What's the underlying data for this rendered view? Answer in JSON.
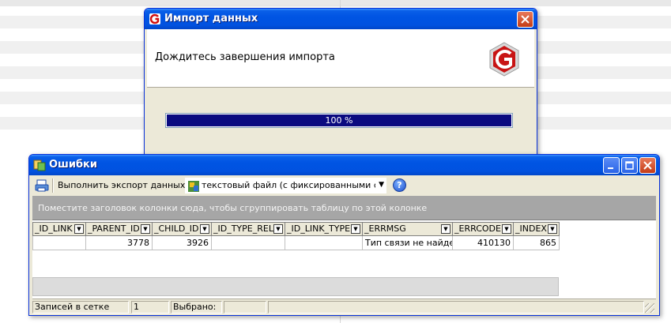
{
  "import_dialog": {
    "title": "Импорт данных",
    "message": "Дождитесь завершения импорта",
    "progress_percent": 100,
    "progress_text": "100 %"
  },
  "errors_window": {
    "title": "Ошибки",
    "toolbar": {
      "export_label": "Выполнить экспорт данных в:",
      "export_format": "текстовый файл (с фиксированными столбц",
      "help_glyph": "?"
    },
    "group_panel_text": "Поместите заголовок колонки сюда, чтобы сгруппировать таблицу по этой колонке",
    "columns": [
      "_ID_LINK",
      "_PARENT_ID",
      "_CHILD_ID",
      "_ID_TYPE_REL",
      "_ID_LINK_TYPE",
      "_ERRMSG",
      "_ERRCODE",
      "_INDEX"
    ],
    "rows": [
      [
        "",
        "3778",
        "3926",
        "",
        "",
        "Тип связи не найден.",
        "410130",
        "865"
      ]
    ],
    "status": {
      "records_label": "Записей в сетке",
      "records_count": "1",
      "selected_label": "Выбрано:",
      "selected_count": ""
    }
  },
  "colors": {
    "title_bar": "#0054e3",
    "progress_fill": "#0a0a80",
    "group_panel": "#a6a6a6",
    "window_face": "#ece9d8"
  },
  "icons": {
    "import_app": "g-app-icon",
    "export": "export-printer-icon",
    "format": "text-file-icon",
    "help": "help-icon"
  }
}
